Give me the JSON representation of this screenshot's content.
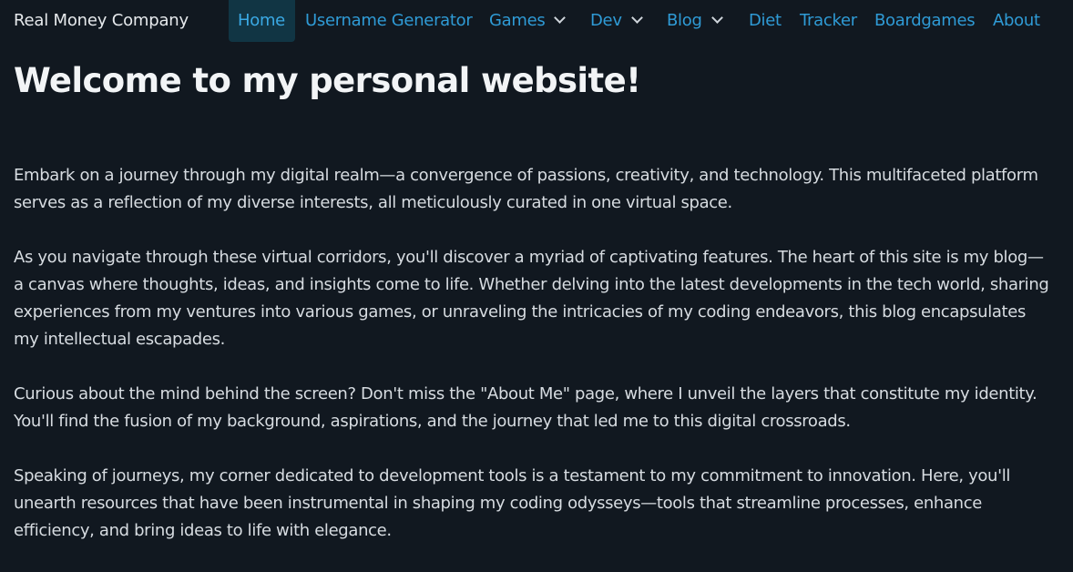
{
  "nav": {
    "brand": "Real Money Company",
    "items": [
      {
        "label": "Home",
        "active": true,
        "dropdown": false
      },
      {
        "label": "Username Generator",
        "active": false,
        "dropdown": false
      },
      {
        "label": "Games",
        "active": false,
        "dropdown": true
      },
      {
        "label": "Dev",
        "active": false,
        "dropdown": true
      },
      {
        "label": "Blog",
        "active": false,
        "dropdown": true
      },
      {
        "label": "Diet",
        "active": false,
        "dropdown": false
      },
      {
        "label": "Tracker",
        "active": false,
        "dropdown": false
      },
      {
        "label": "Boardgames",
        "active": false,
        "dropdown": false
      },
      {
        "label": "About",
        "active": false,
        "dropdown": false
      }
    ]
  },
  "main": {
    "title": "Welcome to my personal website!",
    "paragraphs": [
      "Embark on a journey through my digital realm—a convergence of passions, creativity, and technology. This multifaceted platform serves as a reflection of my diverse interests, all meticulously curated in one virtual space.",
      "As you navigate through these virtual corridors, you'll discover a myriad of captivating features. The heart of this site is my blog—a canvas where thoughts, ideas, and insights come to life. Whether delving into the latest developments in the tech world, sharing experiences from my ventures into various games, or unraveling the intricacies of my coding endeavors, this blog encapsulates my intellectual escapades.",
      "Curious about the mind behind the screen? Don't miss the \"About Me\" page, where I unveil the layers that constitute my identity. You'll find the fusion of my background, aspirations, and the journey that led me to this digital crossroads.",
      "Speaking of journeys, my corner dedicated to development tools is a testament to my commitment to innovation. Here, you'll unearth resources that have been instrumental in shaping my coding odysseys—tools that streamline processes, enhance efficiency, and bring ideas to life with elegance."
    ]
  },
  "colors": {
    "background": "#111820",
    "link": "#2f9bd6",
    "active_bg": "#113544",
    "text": "#d7dce1"
  },
  "icons": {
    "dropdown": "chevron-down-icon"
  }
}
